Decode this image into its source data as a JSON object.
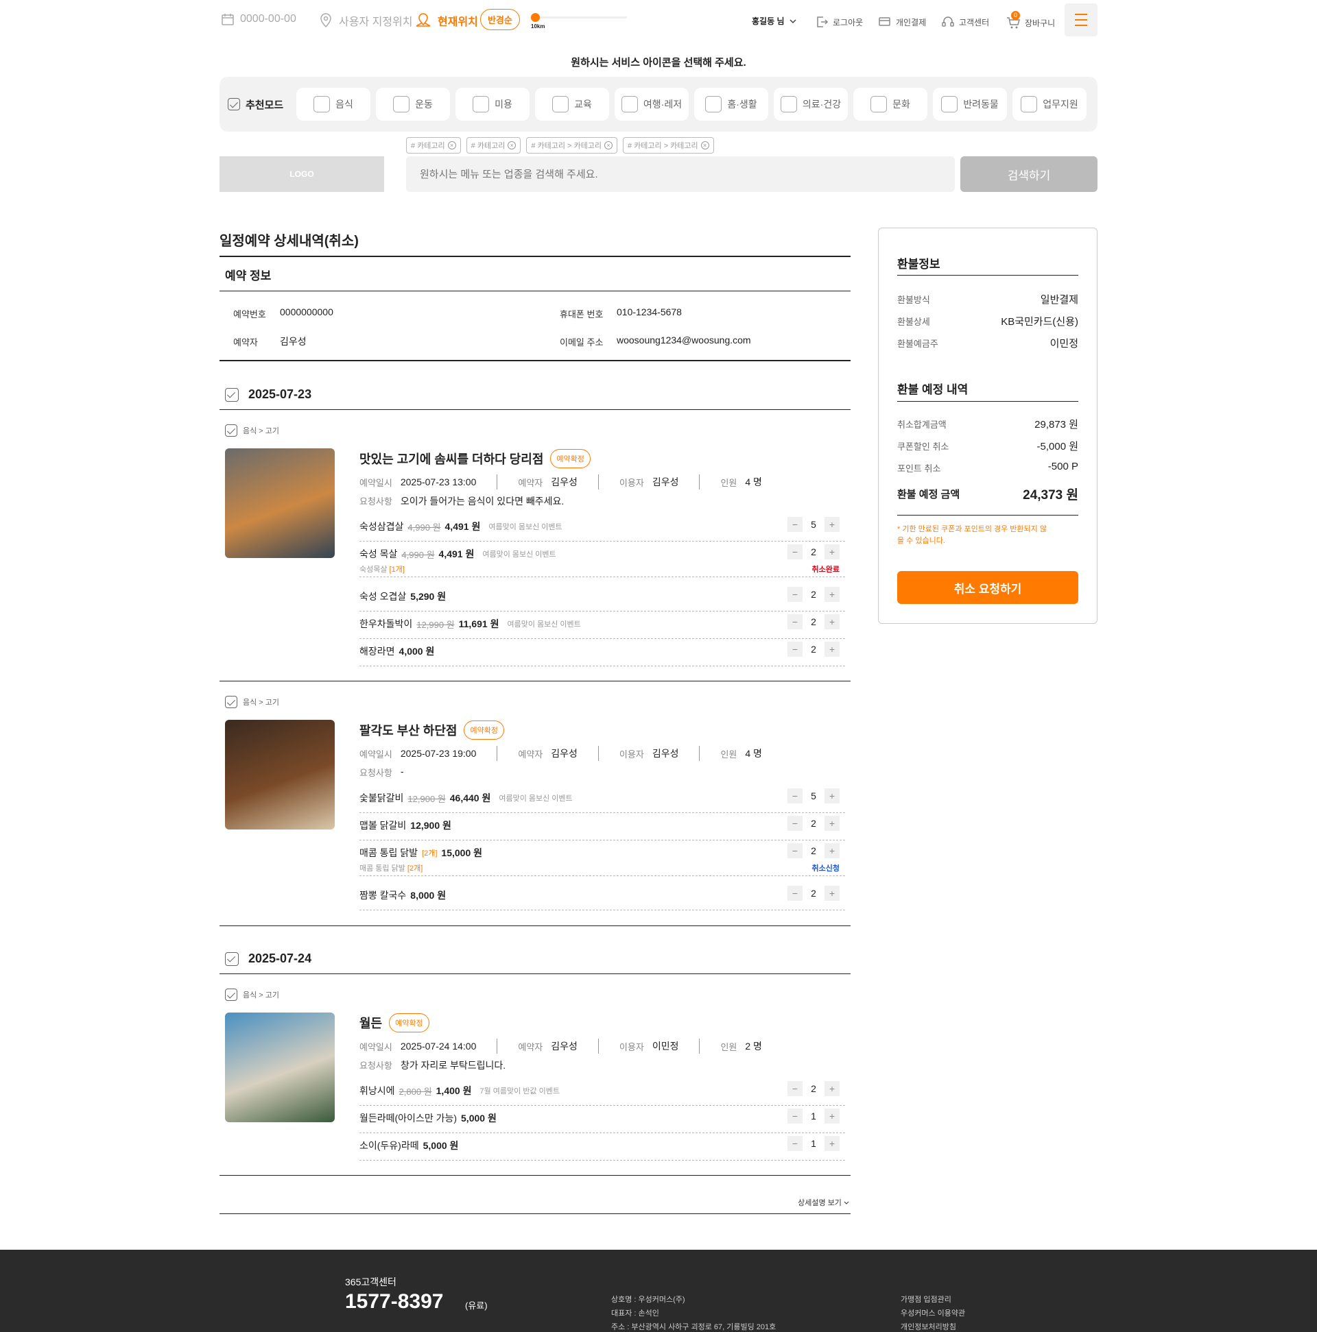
{
  "header": {
    "date": "0000-00-00",
    "custom_location": "사용자 지정위치",
    "current_location": "현재위치",
    "radius_button": "반경순",
    "radius_value": "10km",
    "user": "홍길동 님",
    "logout": "로그아웃",
    "payment": "개인결제",
    "support": "고객센터",
    "cart": "장바구니",
    "cart_count": "0"
  },
  "prompt": "원하시는 서비스 아이콘을 선택해 주세요.",
  "categories": {
    "recommend": "추천모드",
    "items": [
      "음식",
      "운동",
      "미용",
      "교육",
      "여행·레저",
      "홈·생활",
      "의료·건강",
      "문화",
      "반려동물",
      "업무지원"
    ]
  },
  "chips": [
    "# 카테고리",
    "# 카테고리",
    "# 카테고리 > 카테고리",
    "# 카테고리 > 카테고리"
  ],
  "search": {
    "logo": "LOGO",
    "placeholder": "원하시는 메뉴 또는 업종을 검색해 주세요.",
    "button": "검색하기"
  },
  "page_title": "일정예약 상세내역(취소)",
  "reservation": {
    "section": "예약 정보",
    "no_label": "예약번호",
    "no": "0000000000",
    "name_label": "예약자",
    "name": "김우성",
    "phone_label": "휴대폰 번호",
    "phone": "010-1234-5678",
    "email_label": "이메일 주소",
    "email": "woosoung1234@woosung.com"
  },
  "labels": {
    "date": "예약일시",
    "booker": "예약자",
    "user": "이용자",
    "people": "인원",
    "request": "요청사항"
  },
  "days": [
    {
      "date": "2025-07-23",
      "stores": [
        {
          "crumb": "음식 > 고기",
          "name": "맛있는 고기에 솜씨를 더하다 당리점",
          "badge": "예약확정",
          "datetime": "2025-07-23   13:00",
          "booker": "김우성",
          "user": "김우성",
          "people": "4 명",
          "request": "오이가 들어가는 음식이 있다면 빼주세요.",
          "items": [
            {
              "name": "숙성삼겹살",
              "orig": "4,990 원",
              "price": "4,491 원",
              "event": "여름맞이 몸보신 이벤트",
              "qty": "5"
            },
            {
              "name": "숙성 목살",
              "orig": "4,990 원",
              "price": "4,491 원",
              "event": "여름맞이 몸보신 이벤트",
              "qty": "2",
              "sub": "숙성목살",
              "sub_cnt": "[1개]",
              "status": "취소완료",
              "status_color": "#e60012"
            },
            {
              "name": "숙성 오겹살",
              "price": "5,290 원",
              "qty": "2"
            },
            {
              "name": "한우차돌박이",
              "orig": "12,990 원",
              "price": "11,691 원",
              "event": "여름맞이 몸보신 이벤트",
              "qty": "2"
            },
            {
              "name": "해장라면",
              "price": "4,000 원",
              "qty": "2"
            }
          ]
        },
        {
          "crumb": "음식 > 고기",
          "name": "팔각도 부산 하단점",
          "badge": "예약확정",
          "datetime": "2025-07-23   19:00",
          "booker": "김우성",
          "user": "김우성",
          "people": "4 명",
          "request": "-",
          "items": [
            {
              "name": "숯불닭갈비",
              "orig": "12,900 원",
              "price": "46,440 원",
              "event": "여름맞이 몸보신 이벤트",
              "qty": "5"
            },
            {
              "name": "맵볼 닭갈비",
              "price": "12,900 원",
              "qty": "2"
            },
            {
              "name": "매콤 통립 닭발",
              "cnt": "[2개]",
              "price": "15,000 원",
              "qty": "2",
              "sub": "매콤 통립 닭발",
              "sub_cnt": "[2개]",
              "status": "취소신청",
              "status_color": "#1a56db"
            },
            {
              "name": "짬뽕 칼국수",
              "price": "8,000 원",
              "qty": "2"
            }
          ]
        }
      ]
    },
    {
      "date": "2025-07-24",
      "stores": [
        {
          "crumb": "음식 > 고기",
          "name": "월든",
          "badge": "예약확정",
          "datetime": "2025-07-24   14:00",
          "booker": "김우성",
          "user": "이민정",
          "people": "2 명",
          "request": "창가 자리로 부탁드립니다.",
          "items": [
            {
              "name": "휘낭시에",
              "orig": "2,800 원",
              "price": "1,400 원",
              "event": "7월 여름맞이 반값 이벤트",
              "qty": "2"
            },
            {
              "name": "월든라떼(아이스만 가능)",
              "price": "5,000 원",
              "qty": "1"
            },
            {
              "name": "소이(두유)라떼",
              "price": "5,000 원",
              "qty": "1"
            }
          ]
        }
      ]
    }
  ],
  "more": "상세설명 보기",
  "refund": {
    "title": "환불정보",
    "method_label": "환불방식",
    "method": "일반결제",
    "detail_label": "환불상세",
    "detail": "KB국민카드(신용)",
    "holder_label": "환불예금주",
    "holder": "이민정",
    "expected_title": "환불 예정 내역",
    "cancel_total_label": "취소합계금액",
    "cancel_total": "29,873 원",
    "coupon_label": "쿠폰할인 취소",
    "coupon": "-5,000 원",
    "point_label": "포인트 취소",
    "point": "-500 P",
    "final_label": "환불 예정 금액",
    "final": "24,373 원",
    "note": "* 기한 만료된 쿠폰과 포인트의 경우 반환되지 않을 수 있습니다.",
    "button": "취소 요청하기"
  },
  "footer": {
    "cs_title": "365고객센터",
    "phone": "1577-8397",
    "phone_note": "(유료)",
    "company": "상호명 : 우성커머스(주)",
    "ceo": "대표자 : 손석인",
    "address": "주소 : 부산광역시 사하구 괴정로 67, 기룡빌딩 201호",
    "link1": "가맹점 입점관리",
    "link2": "우성커머스 이용약관",
    "link3": "개인정보처리방침"
  },
  "colors": {
    "accent": "#ff7a00",
    "cancel_done": "#e60012",
    "cancel_req": "#1a56db"
  }
}
